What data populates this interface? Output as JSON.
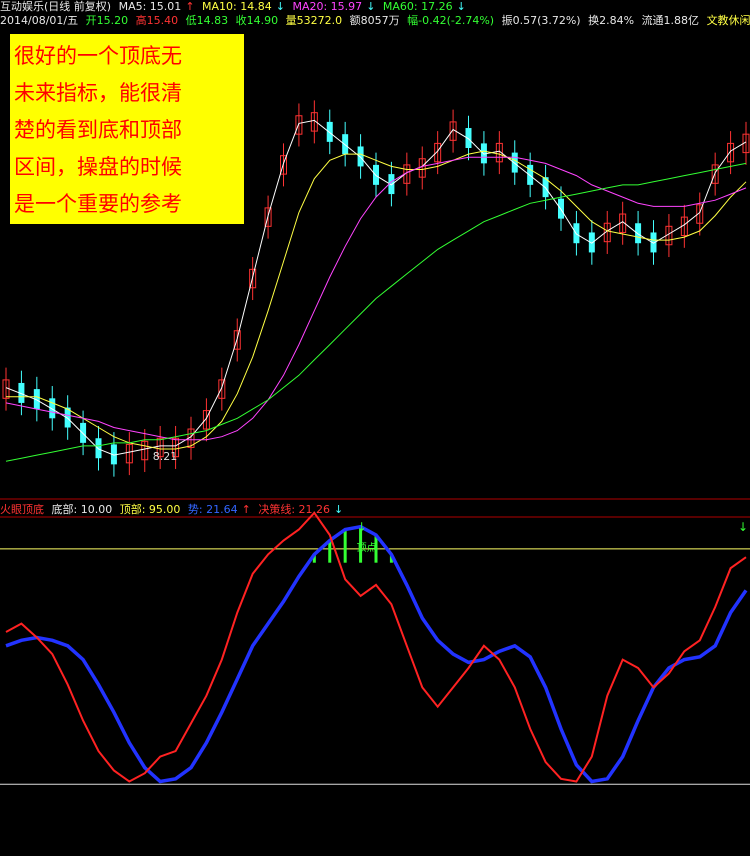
{
  "header": {
    "stock": "互动娱乐(日线 前复权)",
    "ma5": "MA5: 15.01",
    "ma10": "MA10: 14.84",
    "ma20": "MA20: 15.97",
    "ma60": "MA60: 17.26",
    "date": "2014/08/01/五",
    "open": "开15.20",
    "high": "高15.40",
    "low": "低14.83",
    "close": "收14.90",
    "volume": "量53272.0",
    "amount": "额8057万",
    "change": "幅-0.42(-2.74%)",
    "amplitude": "振0.57(3.72%)",
    "turnover": "换2.84%",
    "float": "流通1.88亿",
    "sector": "文教休闲"
  },
  "callout": {
    "lines": [
      "很好的一个顶底无",
      "未来指标，能很清",
      "楚的看到底和顶部",
      "区间，操盘的时候",
      "是一个重要的参考"
    ]
  },
  "indicator_header": {
    "name": "火眼顶底",
    "bottom": "底部: 10.00",
    "top": "顶部: 95.00",
    "trend": "势: 21.64",
    "decision": "决策线: 21.26"
  },
  "annotations": {
    "low_price": "8.21",
    "top_signal": "顶点"
  },
  "colors": {
    "up": "#ff3333",
    "down": "#44ffff",
    "ma5": "#ffffff",
    "ma10": "#ffff44",
    "ma20": "#ff44ff",
    "ma60": "#33ff33",
    "trend": "#2233ff",
    "decision": "#ff2222",
    "top_bar": "#33ff33",
    "level": "#ffff66"
  },
  "chart_data": [
    {
      "type": "candlestick",
      "title": "互动娱乐(日线 前复权)",
      "series": [
        {
          "name": "MA5",
          "values": [
            10.9,
            10.7,
            10.5,
            10.2,
            9.9,
            9.4,
            8.9,
            8.7,
            8.8,
            8.9,
            9.0,
            9.0,
            9.3,
            9.9,
            10.9,
            12.5,
            14.5,
            16.5,
            18.2,
            19.5,
            19.6,
            19.2,
            18.8,
            18.4,
            17.8,
            17.5,
            17.9,
            18.1,
            18.6,
            19.3,
            19.0,
            18.5,
            18.6,
            18.2,
            17.8,
            17.4,
            16.7,
            15.9,
            15.6,
            16.0,
            16.3,
            15.9,
            15.6,
            15.9,
            16.2,
            16.6,
            17.9,
            18.6,
            18.9
          ]
        },
        {
          "name": "MA10",
          "values": [
            10.6,
            10.6,
            10.6,
            10.4,
            10.2,
            9.9,
            9.6,
            9.3,
            9.1,
            9.0,
            8.9,
            8.9,
            9.0,
            9.3,
            9.8,
            10.7,
            11.9,
            13.4,
            15.0,
            16.6,
            17.7,
            18.3,
            18.5,
            18.5,
            18.3,
            18.1,
            18.0,
            18.0,
            18.1,
            18.3,
            18.5,
            18.6,
            18.5,
            18.3,
            18.0,
            17.7,
            17.3,
            16.8,
            16.3,
            16.0,
            15.9,
            15.8,
            15.7,
            15.7,
            15.8,
            16.0,
            16.5,
            17.1,
            17.6
          ]
        },
        {
          "name": "MA20",
          "values": [
            10.4,
            10.3,
            10.2,
            10.1,
            10.0,
            9.9,
            9.8,
            9.6,
            9.5,
            9.4,
            9.3,
            9.2,
            9.2,
            9.2,
            9.3,
            9.5,
            9.9,
            10.5,
            11.3,
            12.3,
            13.4,
            14.5,
            15.5,
            16.4,
            17.1,
            17.6,
            17.9,
            18.1,
            18.2,
            18.3,
            18.4,
            18.4,
            18.4,
            18.4,
            18.3,
            18.2,
            18.0,
            17.8,
            17.5,
            17.3,
            17.1,
            16.9,
            16.8,
            16.8,
            16.8,
            16.9,
            17.0,
            17.2,
            17.4
          ]
        },
        {
          "name": "MA60",
          "values": [
            8.5,
            8.6,
            8.7,
            8.8,
            8.9,
            9.0,
            9.0,
            9.1,
            9.1,
            9.2,
            9.2,
            9.3,
            9.4,
            9.5,
            9.7,
            9.9,
            10.2,
            10.5,
            10.9,
            11.3,
            11.8,
            12.3,
            12.8,
            13.3,
            13.8,
            14.2,
            14.6,
            15.0,
            15.4,
            15.7,
            16.0,
            16.3,
            16.5,
            16.7,
            16.9,
            17.0,
            17.1,
            17.2,
            17.3,
            17.4,
            17.5,
            17.5,
            17.6,
            17.7,
            17.8,
            17.9,
            18.0,
            18.1,
            18.2
          ]
        }
      ],
      "annotations": [
        "8.21"
      ]
    },
    {
      "type": "line",
      "title": "火眼顶底",
      "ylim": [
        0,
        100
      ],
      "levels": [
        {
          "name": "底部",
          "value": 10.0
        },
        {
          "name": "顶部",
          "value": 95.0
        }
      ],
      "series": [
        {
          "name": "势",
          "values": [
            60,
            62,
            63,
            62,
            60,
            55,
            46,
            36,
            25,
            16,
            11,
            12,
            16,
            25,
            36,
            48,
            60,
            68,
            76,
            85,
            93,
            98,
            102,
            103,
            100,
            93,
            82,
            70,
            62,
            57,
            54,
            55,
            58,
            60,
            56,
            45,
            30,
            17,
            11,
            12,
            20,
            33,
            45,
            52,
            55,
            56,
            60,
            72,
            80
          ]
        },
        {
          "name": "决策线",
          "values": [
            65,
            68,
            63,
            57,
            46,
            33,
            22,
            15,
            11,
            14,
            20,
            22,
            32,
            42,
            55,
            72,
            86,
            93,
            98,
            102,
            108,
            100,
            84,
            78,
            82,
            75,
            60,
            45,
            38,
            45,
            52,
            60,
            55,
            45,
            30,
            18,
            12,
            11,
            20,
            42,
            55,
            52,
            45,
            50,
            58,
            62,
            74,
            88,
            92
          ]
        }
      ]
    }
  ]
}
